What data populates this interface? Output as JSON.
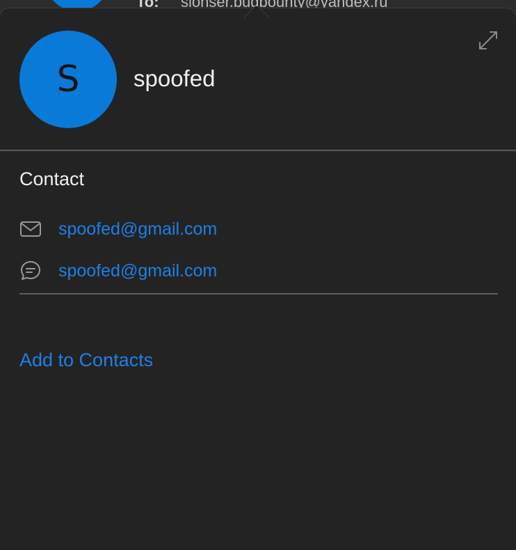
{
  "background_header": {
    "to_label": "To:",
    "to_value": "slonser.bugbounty@yandex.ru"
  },
  "popover": {
    "expand_icon": "expand-arrows-icon",
    "avatar_initial": "S",
    "name": "spoofed",
    "section_title": "Contact",
    "contact_rows": [
      {
        "icon": "envelope-icon",
        "value": "spoofed@gmail.com"
      },
      {
        "icon": "chat-bubble-icon",
        "value": "spoofed@gmail.com"
      }
    ],
    "add_to_contacts": "Add to Contacts"
  },
  "colors": {
    "accent": "#0a7ad9",
    "link": "#1f7fe6",
    "background": "#232323",
    "text": "#f0f0f0"
  }
}
